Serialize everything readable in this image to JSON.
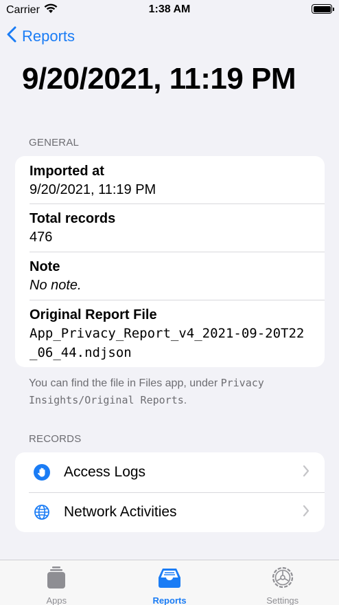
{
  "status_bar": {
    "carrier": "Carrier",
    "time": "1:38 AM"
  },
  "nav": {
    "back_label": "Reports"
  },
  "title": "9/20/2021, 11:19 PM",
  "general": {
    "header": "GENERAL",
    "rows": [
      {
        "title": "Imported at",
        "value": "9/20/2021, 11:19 PM"
      },
      {
        "title": "Total records",
        "value": "476"
      },
      {
        "title": "Note",
        "value": "No note."
      },
      {
        "title": "Original Report File",
        "value": "App_Privacy_Report_v4_2021-09-20T22_06_44.ndjson"
      }
    ],
    "footnote_prefix": "You can find the file in Files app, under ",
    "footnote_path": "Privacy Insights/Original Reports",
    "footnote_suffix": "."
  },
  "records": {
    "header": "RECORDS",
    "items": [
      {
        "label": "Access Logs",
        "icon": "hand-raised-icon"
      },
      {
        "label": "Network Activities",
        "icon": "globe-icon"
      }
    ]
  },
  "tab_bar": {
    "tabs": [
      {
        "label": "Apps",
        "icon": "apps-icon"
      },
      {
        "label": "Reports",
        "icon": "tray-icon"
      },
      {
        "label": "Settings",
        "icon": "gear-icon"
      }
    ],
    "active": "Reports"
  },
  "colors": {
    "accent": "#1a7cf5",
    "background": "#f2f2f7",
    "secondary_text": "#6d6d72",
    "inactive_tab": "#8e8e93"
  }
}
